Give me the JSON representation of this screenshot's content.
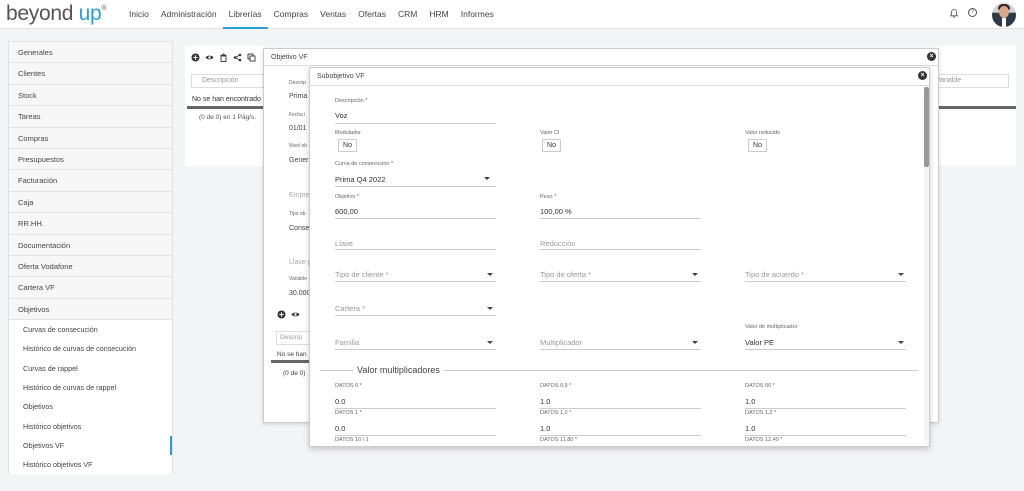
{
  "header": {
    "logo_main": "beyond ",
    "logo_accent": "up",
    "logo_mark": "®",
    "nav": [
      "Inicio",
      "Administración",
      "Librerías",
      "Compras",
      "Ventas",
      "Ofertas",
      "CRM",
      "HRM",
      "Informes"
    ],
    "active_nav": "Librerías",
    "help_glyph": "?"
  },
  "sidebar": {
    "items": [
      "Generales",
      "Clientes",
      "Stock",
      "Tareas",
      "Compras",
      "Presupuestos",
      "Facturación",
      "Caja",
      "RR.HH.",
      "Documentación",
      "Oferta Vodafone",
      "Cartera VF",
      "Objetivos"
    ],
    "subitems": [
      "Curvas de consecución",
      "Histórico de curvas de consecución",
      "Curvas de rappel",
      "Histórico de curvas de rappel",
      "Objetivos",
      "Histórico objetivos",
      "Objetivos VF",
      "Histórico objetivos VF"
    ],
    "active_subitem": "Objetivos VF"
  },
  "main": {
    "search_placeholder": "Descripción",
    "right_placeholder": "Variable",
    "empty_text": "No se han encontrado",
    "pages_text": "(0 de 0) en 1 Pág/s."
  },
  "modal1": {
    "title": "Objetivo VF",
    "close_glyph": "×",
    "labels": [
      "Descrip",
      "Fecha i",
      "Nivel ob",
      "Tipo ob",
      "Variable"
    ],
    "values": [
      "Prima",
      "01/01",
      "Gener",
      "Conse",
      "30.000"
    ],
    "placeholders": [
      "Empre",
      "Llave p"
    ],
    "sub_search_placeholder": "Descrip",
    "sub_empty": "No se han",
    "sub_pages": "(0 de 0)"
  },
  "modal2": {
    "title": "Subobjetivo VF",
    "close_glyph": "×",
    "descripcion": {
      "label": "Descripción *",
      "value": "Voz"
    },
    "modulador": {
      "label": "Modulador",
      "value": "No"
    },
    "valor_ci": {
      "label": "Valor CI",
      "value": "No"
    },
    "valor_reducido": {
      "label": "Valor reducido",
      "value": "No"
    },
    "curva": {
      "label": "Curva de consecución *",
      "value": "Prima Q4 2022"
    },
    "objetivo": {
      "label": "Objetivo *",
      "value": "600,00"
    },
    "peso": {
      "label": "Peso *",
      "value": "100,00 %"
    },
    "llave": {
      "placeholder": "Llave"
    },
    "reduccion": {
      "placeholder": "Reducción"
    },
    "tipo_cliente": {
      "placeholder": "Tipo de cliente *"
    },
    "tipo_oferta": {
      "placeholder": "Tipo de oferta *"
    },
    "tipo_acuerdo": {
      "placeholder": "Tipo de acuerdo *"
    },
    "cartera": {
      "placeholder": "Cartera *"
    },
    "familia": {
      "placeholder": "Familia"
    },
    "multiplicador": {
      "placeholder": "Multiplicador"
    },
    "valor_multiplicador": {
      "label": "Valor de multiplicador",
      "value": "Valor PE"
    },
    "section_title": "Valor multiplicadores",
    "datos": [
      {
        "label": "DATOS 0 *",
        "value": "0.0"
      },
      {
        "label": "DATOS 0,9 *",
        "value": "1.0"
      },
      {
        "label": "DATOS 00 *",
        "value": "1.0"
      },
      {
        "label": "DATOS 1 *",
        "value": "0.0"
      },
      {
        "label": "DATOS 1,0 *",
        "value": "1.0"
      },
      {
        "label": "DATOS 1,2 *",
        "value": "1.0"
      },
      {
        "label": "DATOS 10 \\ 1",
        "value": ""
      },
      {
        "label": "DATOS 11,80 *",
        "value": ""
      },
      {
        "label": "DATOS 12,40 *",
        "value": ""
      }
    ]
  },
  "toolbar_icons": [
    "plus-icon",
    "eye-icon",
    "trash-icon",
    "share-icon",
    "copy-icon"
  ],
  "colors": {
    "accent": "#2a9fd6"
  }
}
